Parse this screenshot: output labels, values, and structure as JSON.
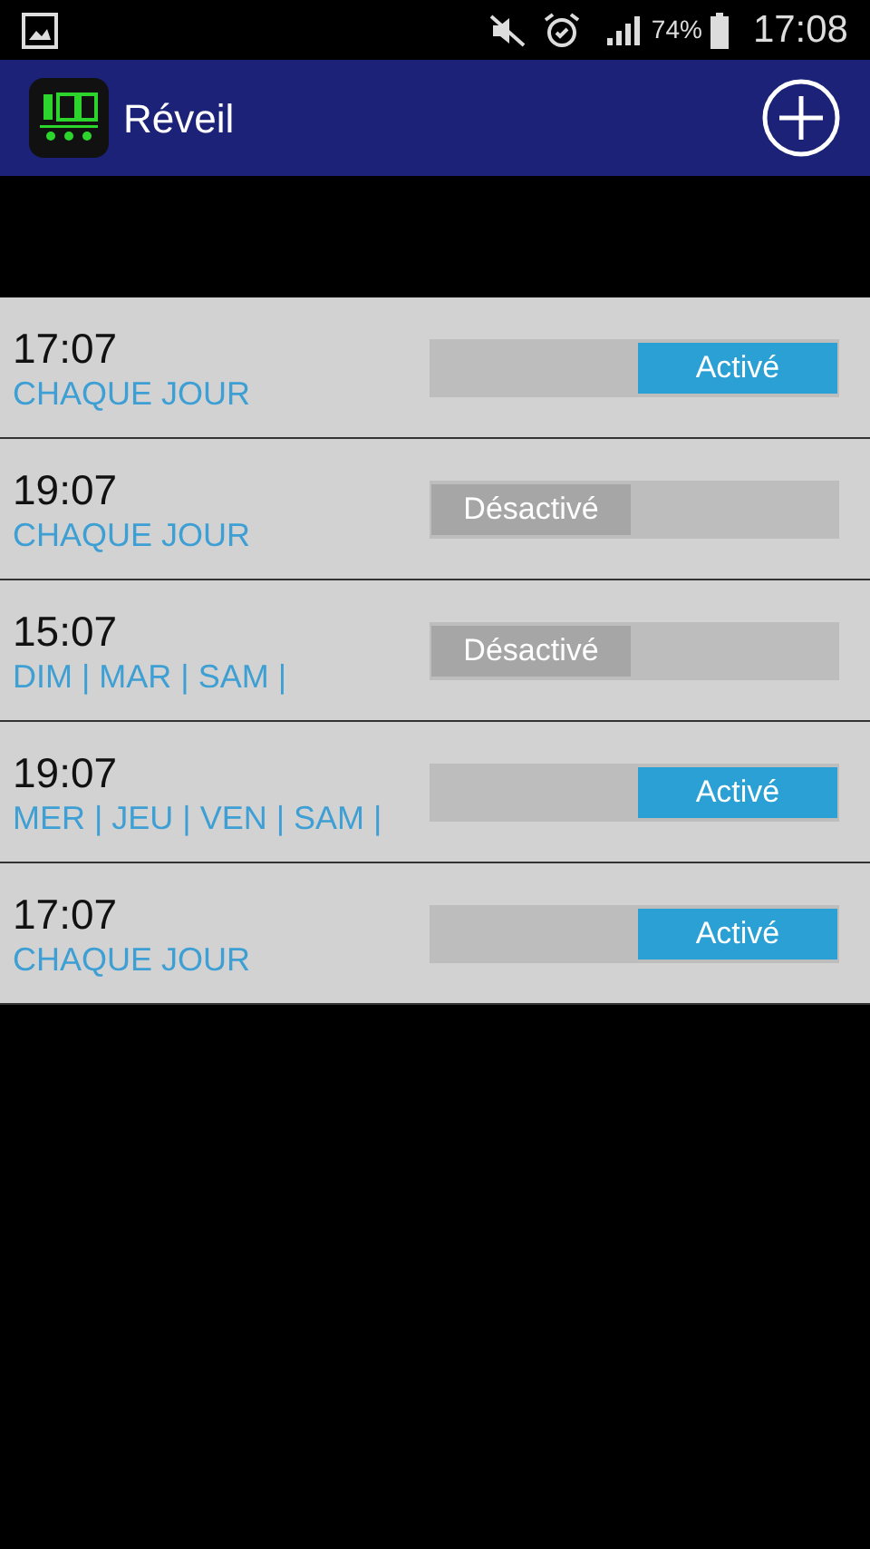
{
  "status_bar": {
    "battery_text": "74%",
    "time": "17:08"
  },
  "app_bar": {
    "title": "Réveil"
  },
  "alarms": [
    {
      "time": "17:07",
      "days": "CHAQUE JOUR",
      "toggle_label": "Activé",
      "on": true
    },
    {
      "time": "19:07",
      "days": "CHAQUE JOUR",
      "toggle_label": "Désactivé",
      "on": false
    },
    {
      "time": "15:07",
      "days": "DIM | MAR | SAM |",
      "toggle_label": "Désactivé",
      "on": false
    },
    {
      "time": "19:07",
      "days": "MER | JEU | VEN | SAM |",
      "toggle_label": "Activé",
      "on": true
    },
    {
      "time": "17:07",
      "days": "CHAQUE JOUR",
      "toggle_label": "Activé",
      "on": true
    }
  ]
}
